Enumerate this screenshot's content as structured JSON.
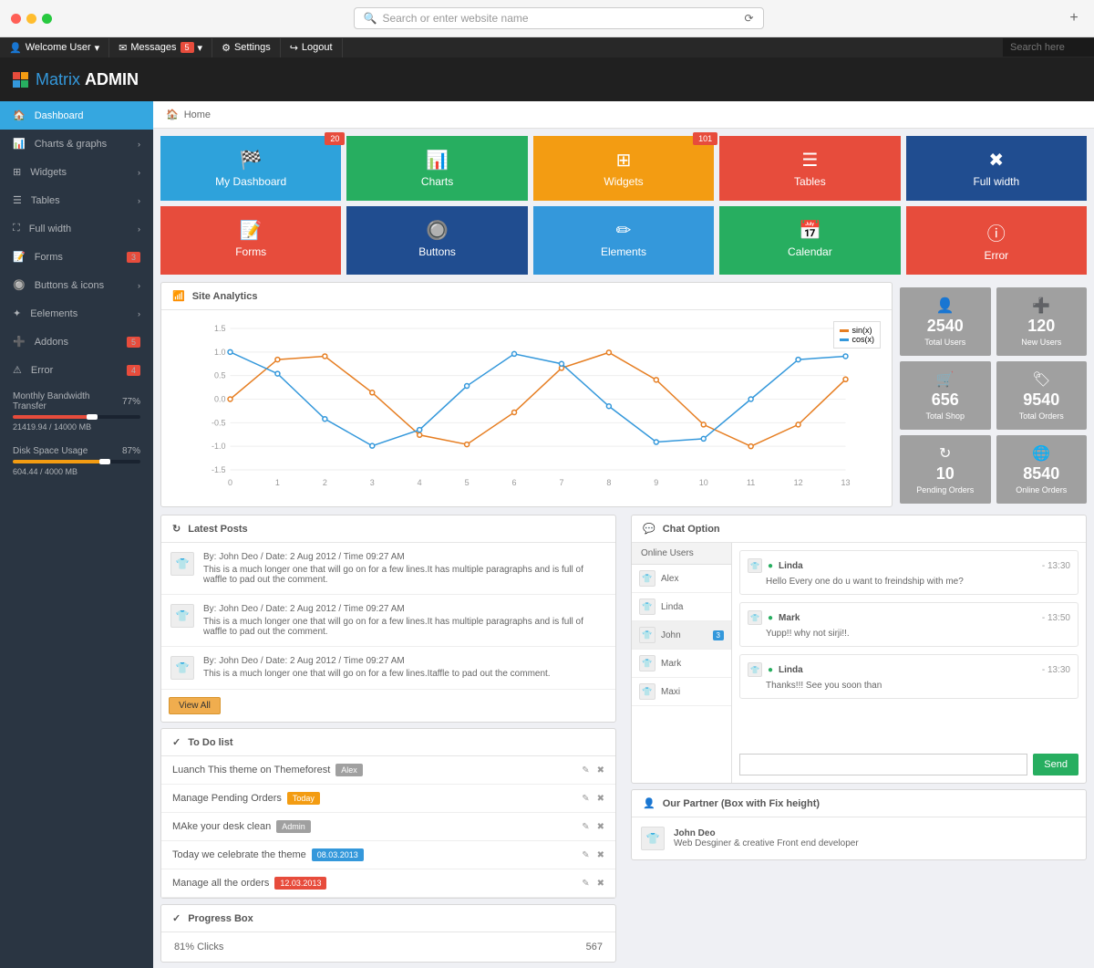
{
  "browser": {
    "url_placeholder": "Search or enter website name"
  },
  "topnav": {
    "welcome": "Welcome User",
    "messages": "Messages",
    "messages_count": "5",
    "settings": "Settings",
    "logout": "Logout",
    "search_placeholder": "Search here"
  },
  "brand": {
    "name1": "Matrix",
    "name2": "ADMIN"
  },
  "breadcrumb": {
    "home": "Home"
  },
  "sidebar": {
    "items": [
      {
        "label": "Dashboard",
        "active": true
      },
      {
        "label": "Charts & graphs"
      },
      {
        "label": "Widgets"
      },
      {
        "label": "Tables"
      },
      {
        "label": "Full width"
      },
      {
        "label": "Forms",
        "badge": "3"
      },
      {
        "label": "Buttons & icons"
      },
      {
        "label": "Eelements"
      },
      {
        "label": "Addons",
        "badge": "5"
      },
      {
        "label": "Error",
        "badge": "4"
      }
    ],
    "bandwidth": {
      "title": "Monthly Bandwidth Transfer",
      "text": "21419.94 / 14000 MB",
      "percent": "77%"
    },
    "disk": {
      "title": "Disk Space Usage",
      "text": "604.44 / 4000 MB",
      "percent": "87%"
    }
  },
  "tiles": [
    {
      "label": "My Dashboard",
      "color": "tile-blue",
      "badge": "20"
    },
    {
      "label": "Charts",
      "color": "tile-green"
    },
    {
      "label": "Widgets",
      "color": "tile-orange",
      "badge": "101"
    },
    {
      "label": "Tables",
      "color": "tile-red"
    },
    {
      "label": "Full width",
      "color": "tile-darkblue"
    },
    {
      "label": "Forms",
      "color": "tile-red"
    },
    {
      "label": "Buttons",
      "color": "tile-darkblue"
    },
    {
      "label": "Elements",
      "color": "tile-brightblue"
    },
    {
      "label": "Calendar",
      "color": "tile-green"
    },
    {
      "label": "Error",
      "color": "tile-red"
    }
  ],
  "analytics": {
    "title": "Site Analytics"
  },
  "chart_data": {
    "type": "line",
    "x": [
      0,
      1,
      2,
      3,
      4,
      5,
      6,
      7,
      8,
      9,
      10,
      11,
      12,
      13
    ],
    "series": [
      {
        "name": "sin(x)",
        "color": "#e67e22",
        "values": [
          0,
          0.84,
          0.91,
          0.14,
          -0.76,
          -0.96,
          -0.28,
          0.66,
          0.99,
          0.41,
          -0.54,
          -1.0,
          -0.54,
          0.42
        ]
      },
      {
        "name": "cos(x)",
        "color": "#3498db",
        "values": [
          1,
          0.54,
          -0.42,
          -0.99,
          -0.65,
          0.28,
          0.96,
          0.75,
          -0.15,
          -0.91,
          -0.84,
          0.0,
          0.84,
          0.91
        ]
      }
    ],
    "yrange": [
      -1.5,
      1.5
    ],
    "yticks": [
      -1.5,
      -1.0,
      -0.5,
      0.0,
      0.5,
      1.0,
      1.5
    ]
  },
  "stats": [
    {
      "value": "2540",
      "label": "Total Users"
    },
    {
      "value": "120",
      "label": "New Users"
    },
    {
      "value": "656",
      "label": "Total Shop"
    },
    {
      "value": "9540",
      "label": "Total Orders"
    },
    {
      "value": "10",
      "label": "Pending Orders"
    },
    {
      "value": "8540",
      "label": "Online Orders"
    }
  ],
  "posts": {
    "title": "Latest Posts",
    "items": [
      {
        "meta": "By: John Deo / Date: 2 Aug 2012 / Time 09:27 AM",
        "text": "This is a much longer one that will go on for a few lines.It has multiple paragraphs and is full of waffle to pad out the comment."
      },
      {
        "meta": "By: John Deo / Date: 2 Aug 2012 / Time 09:27 AM",
        "text": "This is a much longer one that will go on for a few lines.It has multiple paragraphs and is full of waffle to pad out the comment."
      },
      {
        "meta": "By: John Deo / Date: 2 Aug 2012 / Time 09:27 AM",
        "text": "This is a much longer one that will go on for a few lines.Itaffle to pad out the comment."
      }
    ],
    "view_all": "View All"
  },
  "todo": {
    "title": "To Do list",
    "items": [
      {
        "text": "Luanch This theme on Themeforest",
        "tag": "Alex",
        "tagcolor": "#a0a0a0"
      },
      {
        "text": "Manage Pending Orders",
        "tag": "Today",
        "tagcolor": "#f39c12"
      },
      {
        "text": "MAke your desk clean",
        "tag": "Admin",
        "tagcolor": "#a0a0a0"
      },
      {
        "text": "Today we celebrate the theme",
        "tag": "08.03.2013",
        "tagcolor": "#3498db"
      },
      {
        "text": "Manage all the orders",
        "tag": "12.03.2013",
        "tagcolor": "#e74c3c"
      }
    ]
  },
  "progress": {
    "title": "Progress Box",
    "item_label": "81% Clicks",
    "item_value": "567"
  },
  "chat": {
    "title": "Chat Option",
    "online_title": "Online Users",
    "users": [
      {
        "name": "Alex"
      },
      {
        "name": "Linda"
      },
      {
        "name": "John",
        "active": true,
        "badge": "3"
      },
      {
        "name": "Mark"
      },
      {
        "name": "Maxi"
      }
    ],
    "messages": [
      {
        "name": "Linda",
        "time": "- 13:30",
        "text": "Hello Every one do u want to freindship with me?"
      },
      {
        "name": "Mark",
        "time": "- 13:50",
        "text": "Yupp!! why not sirji!!."
      },
      {
        "name": "Linda",
        "time": "- 13:30",
        "text": "Thanks!!! See you soon than"
      }
    ],
    "send": "Send"
  },
  "partner": {
    "title": "Our Partner (Box with Fix height)",
    "name": "John Deo",
    "desc": "Web Desginer & creative Front end developer"
  }
}
